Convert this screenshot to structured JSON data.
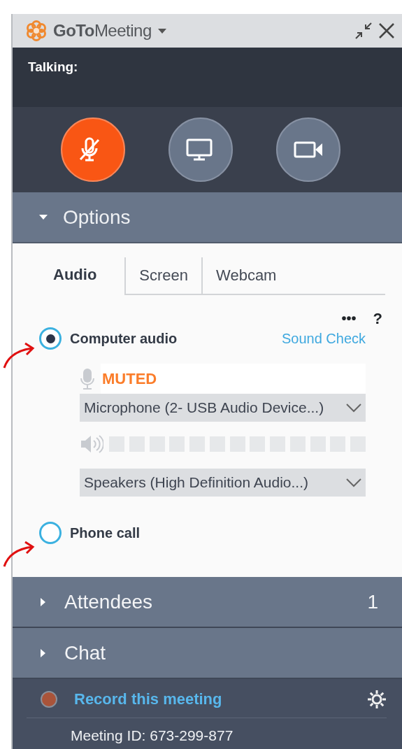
{
  "window": {
    "title": "**GoTo**Meeting"
  },
  "talking": {
    "label": "Talking:"
  },
  "controls": [
    {
      "kind": "microphone",
      "active": true
    },
    {
      "kind": "screen",
      "active": false
    },
    {
      "kind": "webcam",
      "active": false
    }
  ],
  "options": {
    "label": "Options",
    "expanded": true,
    "tabs": [
      {
        "label": "Audio",
        "selected": true
      },
      {
        "label": "Screen",
        "selected": false
      },
      {
        "label": "Webcam",
        "selected": false
      }
    ],
    "more": "•••",
    "help": "?",
    "audio_modes": [
      {
        "label": "Computer audio",
        "selected": true,
        "link": "Sound Check"
      },
      {
        "label": "Phone call",
        "selected": false
      }
    ],
    "mic_status": "MUTED",
    "microphone": "Microphone (2- USB Audio Device...)",
    "speakers": "Speakers (High Definition Audio...)"
  },
  "sections": [
    {
      "label": "Attendees",
      "expanded": false,
      "count": "1"
    },
    {
      "label": "Chat",
      "expanded": false
    }
  ],
  "footer": {
    "record": "Record this meeting",
    "meeting_id": "Meeting ID: 673-299-877"
  }
}
